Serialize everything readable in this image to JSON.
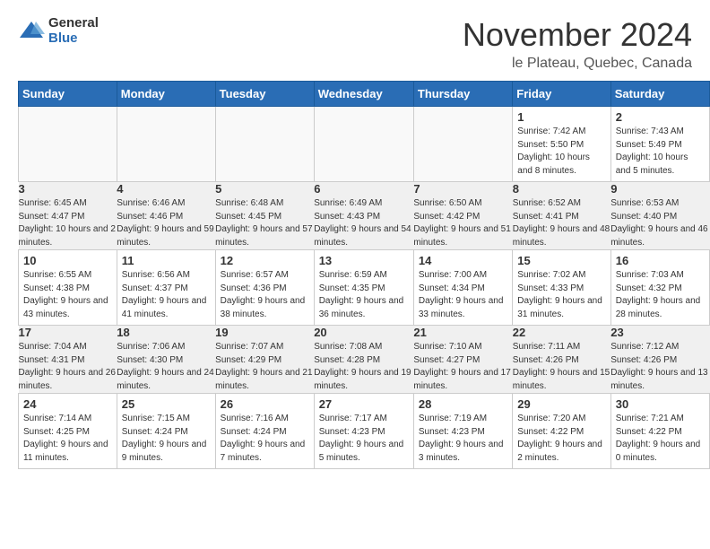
{
  "logo": {
    "general": "General",
    "blue": "Blue"
  },
  "title": "November 2024",
  "location": "le Plateau, Quebec, Canada",
  "weekdays": [
    "Sunday",
    "Monday",
    "Tuesday",
    "Wednesday",
    "Thursday",
    "Friday",
    "Saturday"
  ],
  "weeks": [
    [
      {
        "day": "",
        "info": ""
      },
      {
        "day": "",
        "info": ""
      },
      {
        "day": "",
        "info": ""
      },
      {
        "day": "",
        "info": ""
      },
      {
        "day": "",
        "info": ""
      },
      {
        "day": "1",
        "info": "Sunrise: 7:42 AM\nSunset: 5:50 PM\nDaylight: 10 hours and 8 minutes."
      },
      {
        "day": "2",
        "info": "Sunrise: 7:43 AM\nSunset: 5:49 PM\nDaylight: 10 hours and 5 minutes."
      }
    ],
    [
      {
        "day": "3",
        "info": "Sunrise: 6:45 AM\nSunset: 4:47 PM\nDaylight: 10 hours and 2 minutes."
      },
      {
        "day": "4",
        "info": "Sunrise: 6:46 AM\nSunset: 4:46 PM\nDaylight: 9 hours and 59 minutes."
      },
      {
        "day": "5",
        "info": "Sunrise: 6:48 AM\nSunset: 4:45 PM\nDaylight: 9 hours and 57 minutes."
      },
      {
        "day": "6",
        "info": "Sunrise: 6:49 AM\nSunset: 4:43 PM\nDaylight: 9 hours and 54 minutes."
      },
      {
        "day": "7",
        "info": "Sunrise: 6:50 AM\nSunset: 4:42 PM\nDaylight: 9 hours and 51 minutes."
      },
      {
        "day": "8",
        "info": "Sunrise: 6:52 AM\nSunset: 4:41 PM\nDaylight: 9 hours and 48 minutes."
      },
      {
        "day": "9",
        "info": "Sunrise: 6:53 AM\nSunset: 4:40 PM\nDaylight: 9 hours and 46 minutes."
      }
    ],
    [
      {
        "day": "10",
        "info": "Sunrise: 6:55 AM\nSunset: 4:38 PM\nDaylight: 9 hours and 43 minutes."
      },
      {
        "day": "11",
        "info": "Sunrise: 6:56 AM\nSunset: 4:37 PM\nDaylight: 9 hours and 41 minutes."
      },
      {
        "day": "12",
        "info": "Sunrise: 6:57 AM\nSunset: 4:36 PM\nDaylight: 9 hours and 38 minutes."
      },
      {
        "day": "13",
        "info": "Sunrise: 6:59 AM\nSunset: 4:35 PM\nDaylight: 9 hours and 36 minutes."
      },
      {
        "day": "14",
        "info": "Sunrise: 7:00 AM\nSunset: 4:34 PM\nDaylight: 9 hours and 33 minutes."
      },
      {
        "day": "15",
        "info": "Sunrise: 7:02 AM\nSunset: 4:33 PM\nDaylight: 9 hours and 31 minutes."
      },
      {
        "day": "16",
        "info": "Sunrise: 7:03 AM\nSunset: 4:32 PM\nDaylight: 9 hours and 28 minutes."
      }
    ],
    [
      {
        "day": "17",
        "info": "Sunrise: 7:04 AM\nSunset: 4:31 PM\nDaylight: 9 hours and 26 minutes."
      },
      {
        "day": "18",
        "info": "Sunrise: 7:06 AM\nSunset: 4:30 PM\nDaylight: 9 hours and 24 minutes."
      },
      {
        "day": "19",
        "info": "Sunrise: 7:07 AM\nSunset: 4:29 PM\nDaylight: 9 hours and 21 minutes."
      },
      {
        "day": "20",
        "info": "Sunrise: 7:08 AM\nSunset: 4:28 PM\nDaylight: 9 hours and 19 minutes."
      },
      {
        "day": "21",
        "info": "Sunrise: 7:10 AM\nSunset: 4:27 PM\nDaylight: 9 hours and 17 minutes."
      },
      {
        "day": "22",
        "info": "Sunrise: 7:11 AM\nSunset: 4:26 PM\nDaylight: 9 hours and 15 minutes."
      },
      {
        "day": "23",
        "info": "Sunrise: 7:12 AM\nSunset: 4:26 PM\nDaylight: 9 hours and 13 minutes."
      }
    ],
    [
      {
        "day": "24",
        "info": "Sunrise: 7:14 AM\nSunset: 4:25 PM\nDaylight: 9 hours and 11 minutes."
      },
      {
        "day": "25",
        "info": "Sunrise: 7:15 AM\nSunset: 4:24 PM\nDaylight: 9 hours and 9 minutes."
      },
      {
        "day": "26",
        "info": "Sunrise: 7:16 AM\nSunset: 4:24 PM\nDaylight: 9 hours and 7 minutes."
      },
      {
        "day": "27",
        "info": "Sunrise: 7:17 AM\nSunset: 4:23 PM\nDaylight: 9 hours and 5 minutes."
      },
      {
        "day": "28",
        "info": "Sunrise: 7:19 AM\nSunset: 4:23 PM\nDaylight: 9 hours and 3 minutes."
      },
      {
        "day": "29",
        "info": "Sunrise: 7:20 AM\nSunset: 4:22 PM\nDaylight: 9 hours and 2 minutes."
      },
      {
        "day": "30",
        "info": "Sunrise: 7:21 AM\nSunset: 4:22 PM\nDaylight: 9 hours and 0 minutes."
      }
    ]
  ]
}
